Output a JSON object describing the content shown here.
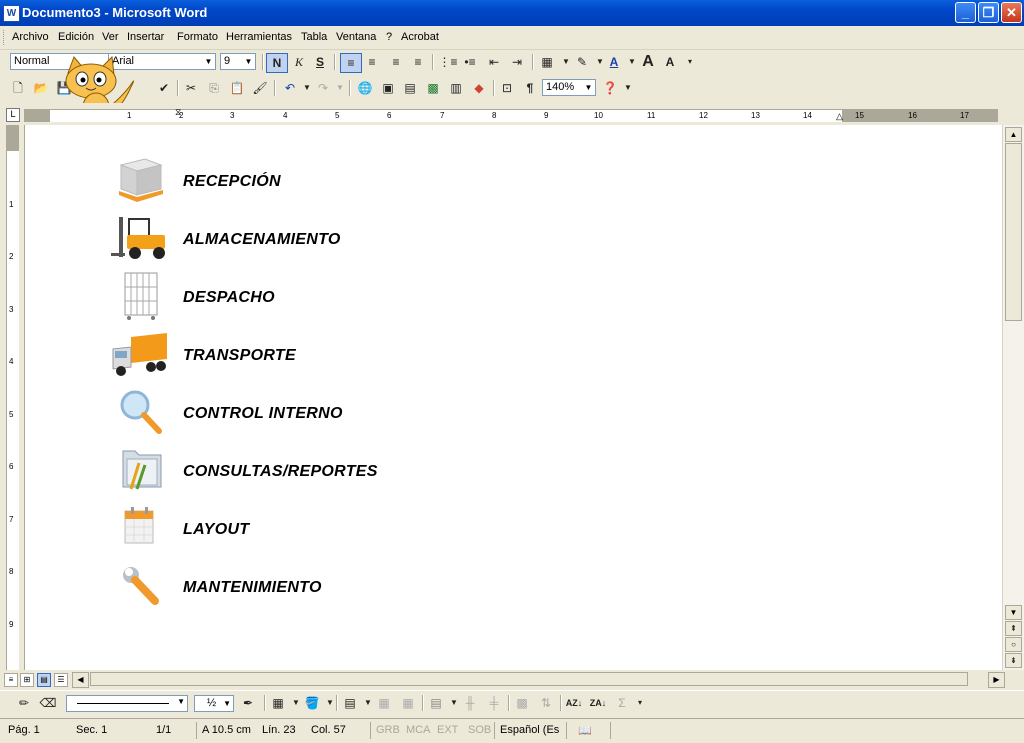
{
  "window": {
    "title": "Documento3 - Microsoft Word",
    "app_icon": "W"
  },
  "menu": [
    "Archivo",
    "Edición",
    "Ver",
    "Insertar",
    "Formato",
    "Herramientas",
    "Tabla",
    "Ventana",
    "?",
    "Acrobat"
  ],
  "format_toolbar": {
    "style": "Normal",
    "font": "Arial",
    "size": "9",
    "bold": "N",
    "italic": "K",
    "underline": "S"
  },
  "standard_toolbar": {
    "zoom": "140%"
  },
  "ruler_numbers": [
    "1",
    "2",
    "3",
    "4",
    "5",
    "6",
    "7",
    "8",
    "9",
    "10",
    "11",
    "12",
    "13",
    "14",
    "15",
    "16",
    "17"
  ],
  "vruler_numbers": [
    "1",
    "2",
    "3",
    "4",
    "5",
    "6",
    "7",
    "8",
    "9"
  ],
  "document_items": [
    {
      "label": "RECEPCIÓN",
      "icon": "pallet-box-icon"
    },
    {
      "label": "ALMACENAMIENTO",
      "icon": "forklift-icon"
    },
    {
      "label": "DESPACHO",
      "icon": "wire-cage-cart-icon"
    },
    {
      "label": "TRANSPORTE",
      "icon": "truck-icon"
    },
    {
      "label": "CONTROL INTERNO",
      "icon": "magnifier-icon"
    },
    {
      "label": "CONSULTAS/REPORTES",
      "icon": "folder-pencil-icon"
    },
    {
      "label": "LAYOUT",
      "icon": "calendar-icon"
    },
    {
      "label": "MANTENIMIENTO",
      "icon": "wrench-icon"
    }
  ],
  "drawing_toolbar": {
    "line_weight": "½"
  },
  "status": {
    "page": "Pág. 1",
    "section": "Sec. 1",
    "pages": "1/1",
    "at": "A 10.5 cm",
    "line": "Lín. 23",
    "col": "Col. 57",
    "grb": "GRB",
    "mca": "MCA",
    "ext": "EXT",
    "sob": "SOB",
    "lang": "Español (Es"
  }
}
